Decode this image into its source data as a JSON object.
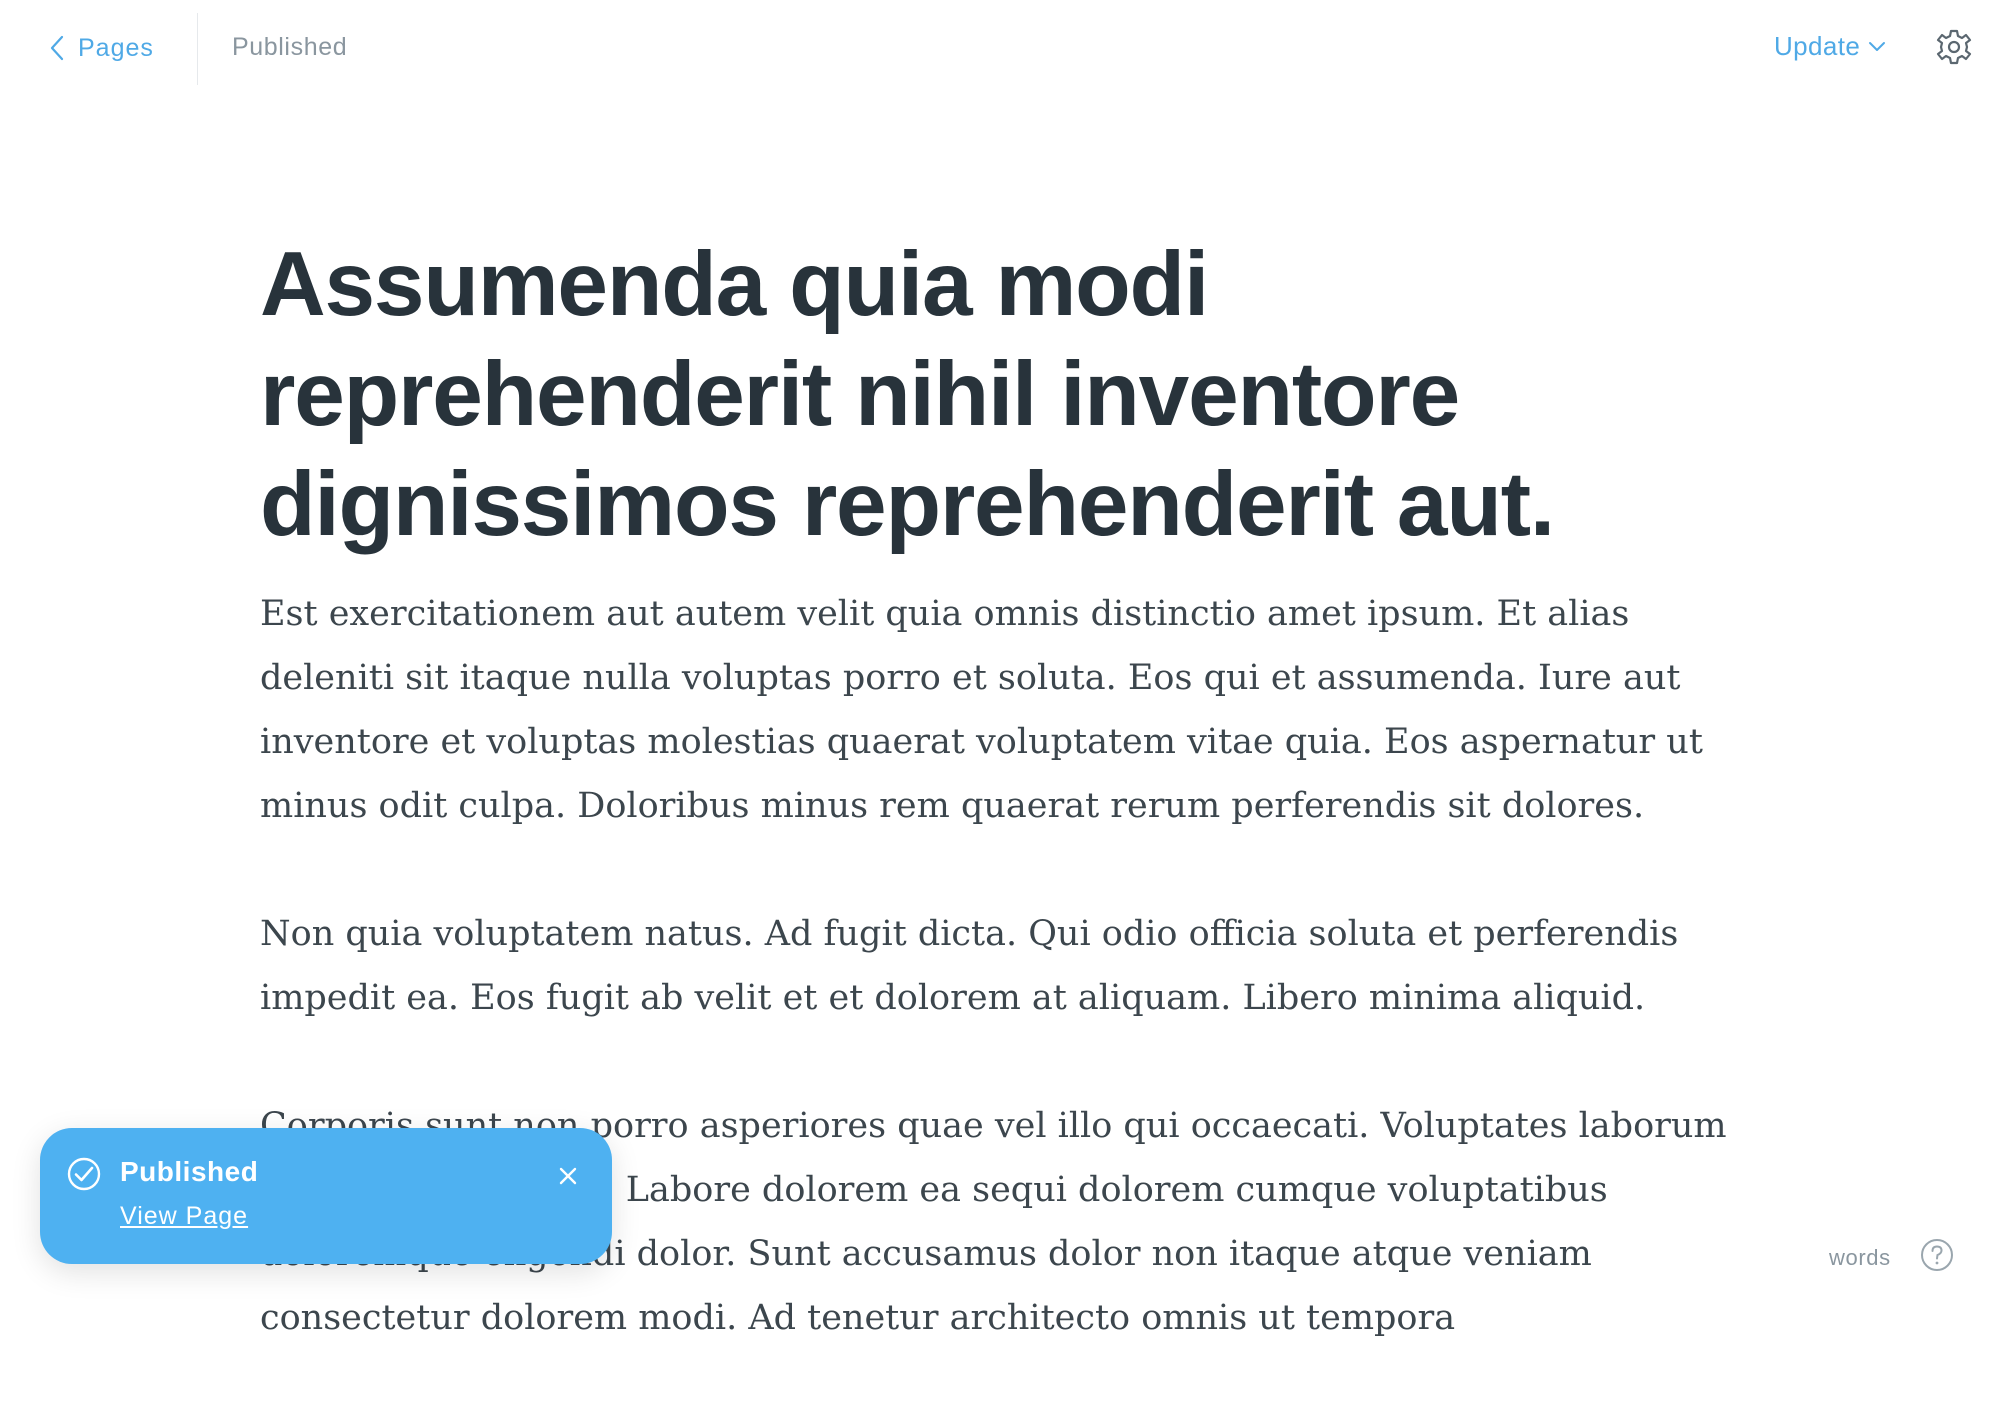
{
  "header": {
    "back_label": "Pages",
    "status": "Published",
    "update_label": "Update"
  },
  "icons": {
    "back": "chevron-left-icon",
    "update_menu": "chevron-down-icon",
    "settings": "gear-icon",
    "toast_status": "check-circle-icon",
    "toast_close": "close-icon",
    "help": "question-circle-icon"
  },
  "colors": {
    "accent": "#4fa9e6",
    "toast_background": "#4eb1f1",
    "title_text": "#28333b",
    "body_text": "#3c464d",
    "muted_text": "#8a969f"
  },
  "editor": {
    "title": "Assumenda quia modi reprehenderit nihil inventore dignissimos reprehenderit aut.",
    "paragraphs": [
      "Est exercitationem aut autem velit quia omnis distinctio amet ipsum. Et alias deleniti sit itaque nulla voluptas porro et soluta. Eos qui et assumenda. Iure aut inventore et voluptas molestias quaerat voluptatem vitae quia. Eos aspernatur ut minus odit culpa. Doloribus minus rem quaerat rerum perferendis sit dolores.",
      "Non quia voluptatem natus. Ad fugit dicta. Qui odio officia soluta et perferendis impedit ea. Eos fugit ab velit et et dolorem at aliquam. Libero minima aliquid.",
      "Corporis sunt non porro asperiores quae vel illo qui occaecati. Voluptates laborum excepturi distinctio. Labore dolorem ea sequi dolorem cumque voluptatibus doloremque eligendi dolor. Sunt accusamus dolor non itaque atque veniam consectetur dolorem modi. Ad tenetur architecto omnis ut tempora"
    ]
  },
  "toast": {
    "title": "Published",
    "link": "View Page"
  },
  "footer": {
    "word_count_label": "words"
  }
}
